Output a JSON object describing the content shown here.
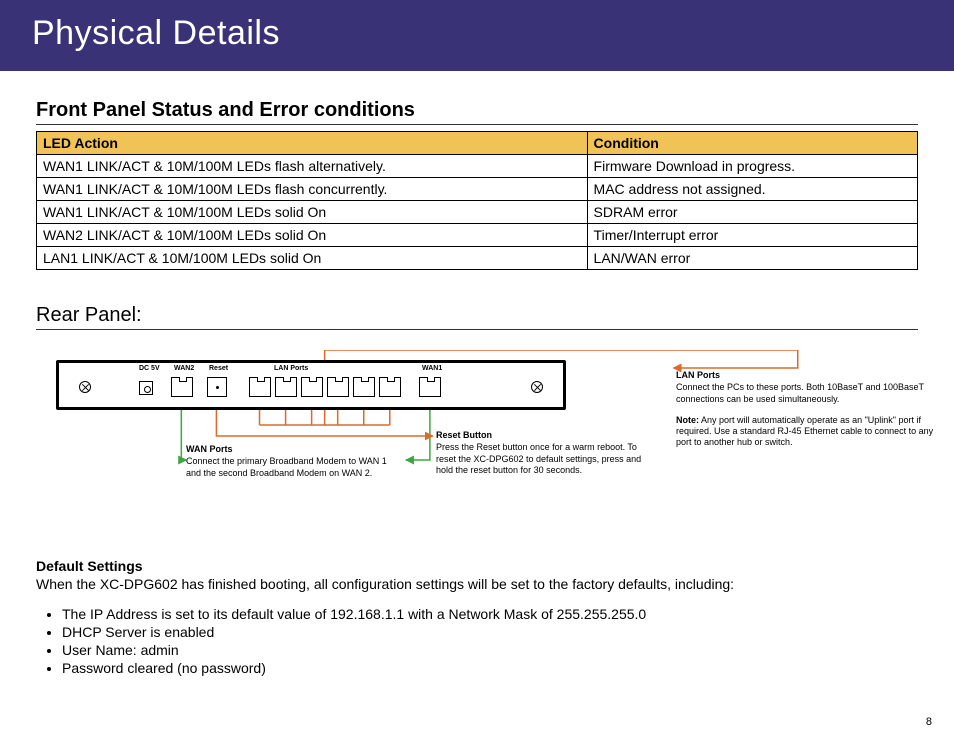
{
  "header": {
    "title": "Physical Details"
  },
  "front_panel": {
    "heading": "Front Panel Status and Error conditions",
    "columns": {
      "led": "LED Action",
      "cond": "Condition"
    },
    "rows": [
      {
        "led": "WAN1 LINK/ACT & 10M/100M LEDs flash alternatively.",
        "cond": "Firmware Download in progress."
      },
      {
        "led": "WAN1 LINK/ACT & 10M/100M LEDs flash concurrently.",
        "cond": "MAC address not assigned."
      },
      {
        "led": "WAN1 LINK/ACT & 10M/100M LEDs solid On",
        "cond": "SDRAM error"
      },
      {
        "led": "WAN2 LINK/ACT & 10M/100M LEDs solid On",
        "cond": "Timer/Interrupt error"
      },
      {
        "led": "LAN1 LINK/ACT & 10M/100M LEDs solid On",
        "cond": "LAN/WAN error"
      }
    ]
  },
  "rear_panel": {
    "heading": "Rear Panel:",
    "labels": {
      "dc": "DC 5V",
      "wan2": "WAN2",
      "reset": "Reset",
      "lan": "LAN Ports",
      "wan1": "WAN1"
    },
    "callouts": {
      "wan": {
        "title": "WAN Ports",
        "body": "Connect the primary Broadband Modem to WAN 1 and the second Broadband Modem on WAN 2."
      },
      "reset": {
        "title": "Reset Button",
        "body": "Press the Reset button once for a warm reboot.  To reset the XC-DPG602 to default settings, press and hold the reset button for 30 seconds."
      },
      "lan": {
        "title": "LAN Ports",
        "body": "Connect the PCs to these ports. Both 10BaseT and 100BaseT connections can be used simultaneously.",
        "note_label": "Note:",
        "note": "Any port will automatically operate as an \"Uplink\" port if required. Use a standard RJ-45 Ethernet cable to connect to any port to another hub or switch."
      }
    }
  },
  "defaults": {
    "heading": "Default Settings",
    "intro": "When the XC-DPG602 has finished booting, all configuration settings will be set to the factory defaults, including:",
    "items": [
      "The IP Address is set to its default value of 192.168.1.1 with a Network Mask of 255.255.255.0",
      "DHCP Server is enabled",
      "User Name: admin",
      "Password cleared (no password)"
    ]
  },
  "page_number": "8",
  "colors": {
    "header_bg": "#3a3277",
    "table_header": "#f1c356",
    "orange": "#d96b2a",
    "green": "#3fa53f"
  }
}
